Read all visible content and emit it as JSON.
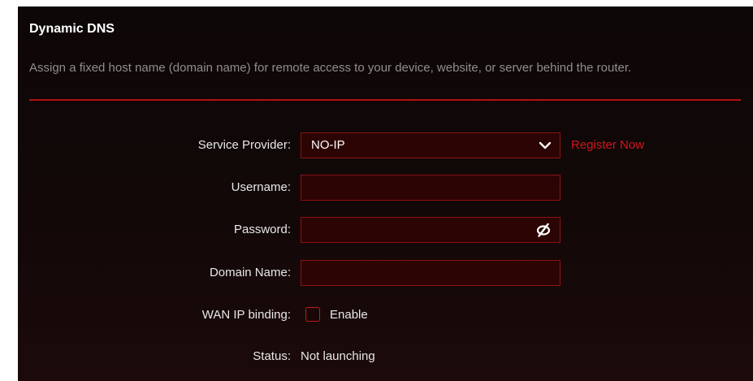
{
  "section": {
    "title": "Dynamic DNS",
    "description": "Assign a fixed host name (domain name) for remote access to your device, website, or server behind the router."
  },
  "form": {
    "service_provider": {
      "label": "Service Provider:",
      "selected": "NO-IP",
      "register_link": "Register Now"
    },
    "username": {
      "label": "Username:",
      "value": ""
    },
    "password": {
      "label": "Password:",
      "value": "",
      "toggle_icon": "eye-slash-icon"
    },
    "domain_name": {
      "label": "Domain Name:",
      "value": ""
    },
    "wan_ip_binding": {
      "label": "WAN IP binding:",
      "checkbox_label": "Enable",
      "checked": false
    },
    "status": {
      "label": "Status:",
      "value": "Not launching"
    }
  },
  "colors": {
    "accent_red": "#d4141c",
    "panel_bg": "#120808",
    "field_bg": "#2c0404",
    "field_border": "#8d1212"
  }
}
